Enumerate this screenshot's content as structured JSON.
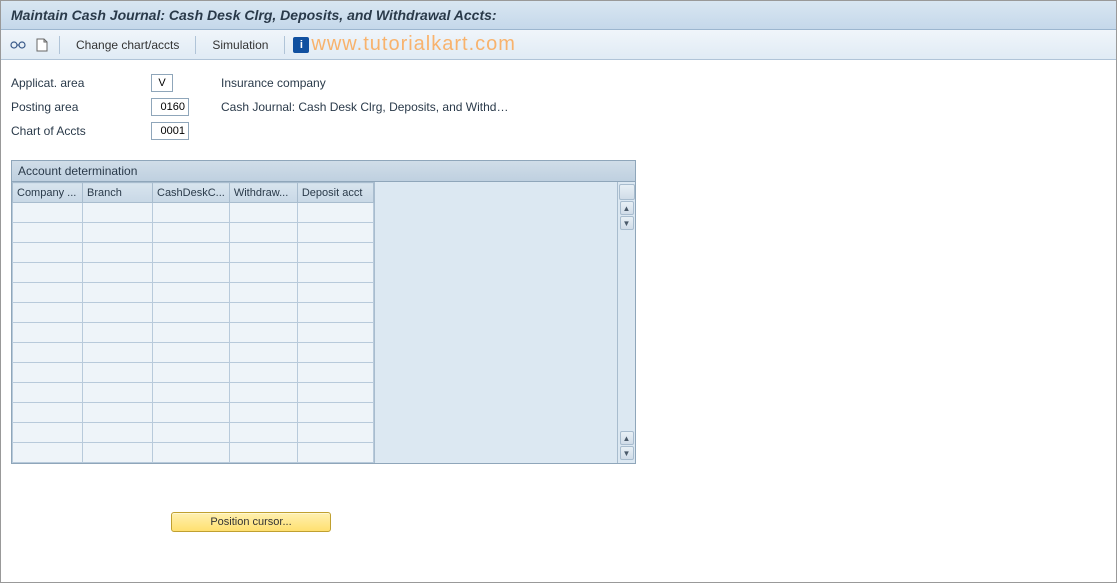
{
  "title": "Maintain Cash Journal: Cash Desk Clrg, Deposits, and Withdrawal Accts:",
  "toolbar": {
    "change_chart_label": "Change chart/accts",
    "simulation_label": "Simulation"
  },
  "watermark": "www.tutorialkart.com",
  "fields": {
    "applicat_area": {
      "label": "Applicat. area",
      "value": "V",
      "desc": "Insurance company"
    },
    "posting_area": {
      "label": "Posting area",
      "value": "0160",
      "desc": "Cash Journal: Cash Desk Clrg, Deposits, and Withd…"
    },
    "chart_of_accts": {
      "label": "Chart of Accts",
      "value": "0001",
      "desc": ""
    }
  },
  "panel": {
    "title": "Account determination",
    "columns": {
      "company": "Company ...",
      "branch": "Branch",
      "cashdesk": "CashDeskC...",
      "withdraw": "Withdraw...",
      "deposit": "Deposit acct"
    },
    "row_count": 13
  },
  "buttons": {
    "position_cursor": "Position cursor..."
  }
}
